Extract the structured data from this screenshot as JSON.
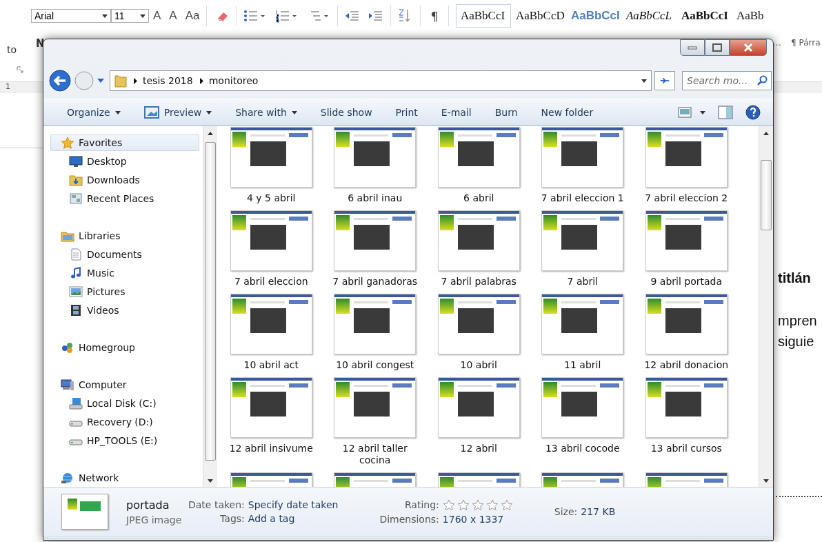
{
  "word": {
    "font": "Arial",
    "size": "11",
    "format_buttons": [
      "A",
      "A",
      "Aa"
    ],
    "pilcrow": "¶",
    "styles": [
      {
        "sample": "AaBbCcI",
        "kind": "normal",
        "selected": true
      },
      {
        "sample": "AaBbCcD",
        "kind": "plain",
        "selected": false
      },
      {
        "sample": "AaBbCcI",
        "kind": "heading",
        "selected": false
      },
      {
        "sample": "AaBbCcL",
        "kind": "emphasis",
        "selected": false
      },
      {
        "sample": "AaBbCcI",
        "kind": "strong",
        "selected": false
      },
      {
        "sample": "AaBb",
        "kind": "plain",
        "selected": false
      }
    ],
    "left_text": "to",
    "style_letter": "N",
    "ellipsis": "…",
    "paragraph_group": "¶ Párra",
    "ruler_number": "1",
    "document_lines": [
      {
        "text": "titlán",
        "kind": "heading"
      },
      {
        "text": "mpren",
        "kind": "body"
      },
      {
        "text": "siguie",
        "kind": "body"
      }
    ]
  },
  "explorer": {
    "breadcrumb": [
      "tesis 2018",
      "monitoreo"
    ],
    "search": {
      "placeholder": "Search mo..."
    },
    "toolbar": [
      {
        "label": "Organize",
        "kind": "menu"
      },
      {
        "label": "Preview",
        "kind": "preview"
      },
      {
        "label": "Share with",
        "kind": "menu"
      },
      {
        "label": "Slide show",
        "kind": "plain"
      },
      {
        "label": "Print",
        "kind": "plain"
      },
      {
        "label": "E-mail",
        "kind": "plain"
      },
      {
        "label": "Burn",
        "kind": "plain"
      },
      {
        "label": "New folder",
        "kind": "plain"
      }
    ],
    "nav": [
      {
        "label": "Favorites",
        "kind": "star",
        "selected": true,
        "children": [
          {
            "label": "Desktop",
            "kind": "desktop",
            "selected": false
          },
          {
            "label": "Downloads",
            "kind": "downloads",
            "selected": false
          },
          {
            "label": "Recent Places",
            "kind": "recent",
            "selected": false
          }
        ]
      },
      {
        "label": "Libraries",
        "kind": "library",
        "selected": false,
        "children": [
          {
            "label": "Documents",
            "kind": "document",
            "selected": false
          },
          {
            "label": "Music",
            "kind": "music",
            "selected": false
          },
          {
            "label": "Pictures",
            "kind": "pictures",
            "selected": false
          },
          {
            "label": "Videos",
            "kind": "videos",
            "selected": false
          }
        ]
      },
      {
        "label": "Homegroup",
        "kind": "homegroup",
        "selected": false
      },
      {
        "label": "Computer",
        "kind": "computer",
        "selected": false,
        "children": [
          {
            "label": "Local Disk (C:)",
            "kind": "disk",
            "selected": false
          },
          {
            "label": "Recovery (D:)",
            "kind": "drive",
            "selected": false
          },
          {
            "label": "HP_TOOLS (E:)",
            "kind": "drive",
            "selected": false
          }
        ]
      },
      {
        "label": "Network",
        "kind": "network",
        "selected": false
      }
    ],
    "files": [
      {
        "name": "4 y 5 abril",
        "kind": "image"
      },
      {
        "name": "6 abril inau",
        "kind": "image"
      },
      {
        "name": "6 abril",
        "kind": "image"
      },
      {
        "name": "7 abril eleccion 1",
        "kind": "image"
      },
      {
        "name": "7 abril eleccion 2",
        "kind": "image"
      },
      {
        "name": "7 abril eleccion",
        "kind": "image"
      },
      {
        "name": "7 abril ganadoras",
        "kind": "image"
      },
      {
        "name": "7 abril palabras",
        "kind": "image"
      },
      {
        "name": "7 abril",
        "kind": "image"
      },
      {
        "name": "9 abril portada",
        "kind": "image"
      },
      {
        "name": "10 abril act",
        "kind": "image"
      },
      {
        "name": "10 abril congest",
        "kind": "image"
      },
      {
        "name": "10 abril",
        "kind": "image"
      },
      {
        "name": "11 abril",
        "kind": "image"
      },
      {
        "name": "12 abril donacion",
        "kind": "image"
      },
      {
        "name": "12 abril insivume",
        "kind": "image"
      },
      {
        "name": "12 abril taller cocina",
        "kind": "image"
      },
      {
        "name": "12 abril",
        "kind": "image"
      },
      {
        "name": "13 abril cocode",
        "kind": "image"
      },
      {
        "name": "13 abril cursos",
        "kind": "image"
      },
      {
        "kind": "partial"
      },
      {
        "kind": "partial"
      },
      {
        "kind": "partial"
      },
      {
        "kind": "partial"
      },
      {
        "kind": "partial"
      }
    ],
    "details": {
      "name": "portada",
      "type": "JPEG image",
      "columns": [
        {
          "fields": [
            {
              "label": "Date taken:",
              "value": "Specify date taken",
              "kind": "text"
            },
            {
              "label": "Tags:",
              "value": "Add a tag",
              "kind": "text"
            }
          ]
        },
        {
          "fields": [
            {
              "label": "Rating:",
              "stars": 0,
              "kind": "rating"
            },
            {
              "label": "Dimensions:",
              "value": "1760 x 1337",
              "kind": "text"
            }
          ]
        },
        {
          "fields": [
            {
              "label": "Size:",
              "value": "217 KB",
              "kind": "text"
            }
          ]
        }
      ]
    }
  }
}
